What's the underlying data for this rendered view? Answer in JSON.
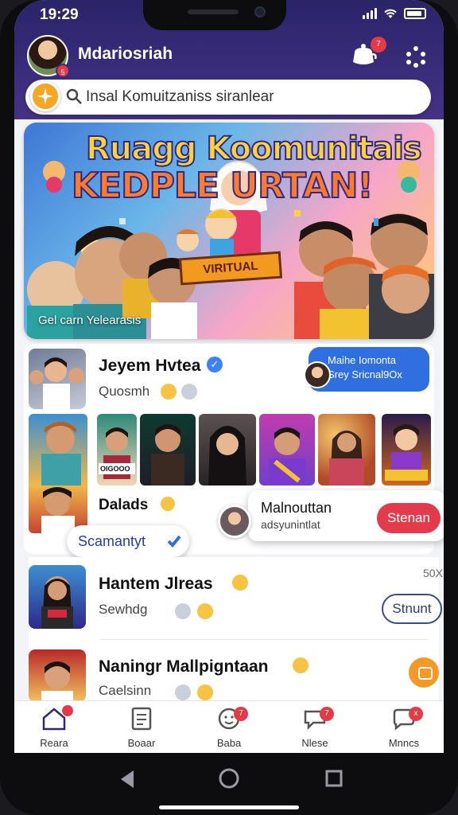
{
  "status": {
    "time": "19:29",
    "battery_icon": "battery-icon",
    "wifi_icon": "wifi-icon",
    "signal_icon": "signal-icon"
  },
  "header": {
    "username": "Mdariosriah",
    "avatar_badge": "5",
    "bell_badge": "7",
    "bell_icon": "teapot-bell-icon",
    "menu_icon": "dots-grid-icon"
  },
  "search": {
    "placeholder": "Insal Komuitzaniss siranlear"
  },
  "banner": {
    "title_line1": "Ruagg Koomunitais",
    "title_line2": "KEDPLE URTAN!",
    "ribbon": "VIRITUAL",
    "caption": "Gel carn Yelearasis"
  },
  "feed": {
    "row1": {
      "title": "Jeyem Hvtea",
      "subtitle": "Quosmh"
    },
    "bubble": {
      "line1": "Maihe Iomonta",
      "line2": "Srey Sricnal9Ox"
    },
    "gallery_caption": "OIGOOO",
    "row2": {
      "title": "Dalads"
    },
    "popup": {
      "title": "Malnouttan",
      "subtitle": "adsyunintlat",
      "button": "Stenan"
    },
    "pill": "Scamantyt",
    "row3": {
      "title": "Hantem Jlreas",
      "subtitle": "Sewhdg",
      "button": "Stnunt",
      "time": "50X"
    },
    "row4": {
      "title": "Naningr Mallpigntaan",
      "subtitle": "Caelsinn"
    }
  },
  "nav": [
    {
      "label": "Reara",
      "icon": "home-icon",
      "badge": ""
    },
    {
      "label": "Boaar",
      "icon": "board-icon",
      "badge": ""
    },
    {
      "label": "Baba",
      "icon": "chat-face-icon",
      "badge": "7"
    },
    {
      "label": "Nlese",
      "icon": "chat-bubble-icon",
      "badge": "7"
    },
    {
      "label": "Mnncs",
      "icon": "message-icon",
      "badge": "x"
    }
  ],
  "colors": {
    "header": "#3a2d7c",
    "accent_red": "#e33b4b",
    "accent_blue": "#2f6fe0",
    "accent_orange": "#f39a26"
  }
}
